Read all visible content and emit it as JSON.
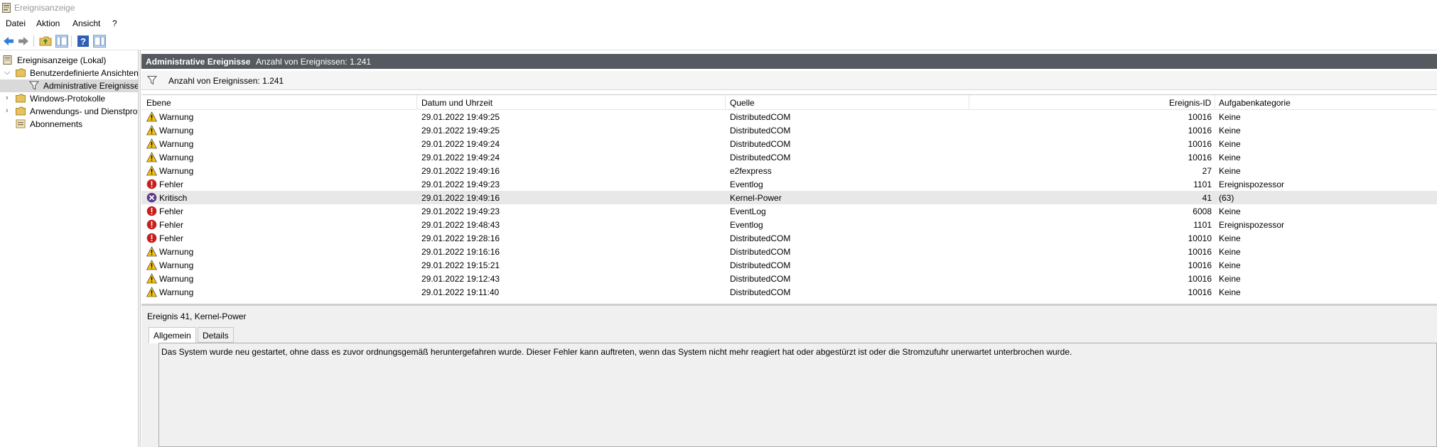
{
  "window": {
    "title": "Ereignisanzeige"
  },
  "menu": [
    {
      "label": "Datei"
    },
    {
      "label": "Aktion"
    },
    {
      "label": "Ansicht"
    },
    {
      "label": "?"
    }
  ],
  "toolbar": {
    "icons": [
      "back-arrow-icon",
      "forward-arrow-icon",
      "folder-up-icon",
      "show-hide-tree-icon",
      "help-icon",
      "show-hide-action-pane-icon"
    ]
  },
  "tree": {
    "root": "Ereignisanzeige (Lokal)",
    "custom_views": "Benutzerdefinierte Ansichten",
    "admin_events": "Administrative Ereignisse",
    "windows_logs": "Windows-Protokolle",
    "app_logs": "Anwendungs- und Dienstprotokolle",
    "subscriptions": "Abonnements"
  },
  "pane": {
    "title": "Administrative Ereignisse",
    "count": "Anzahl von Ereignissen: 1.241"
  },
  "filter": {
    "text": "Anzahl von Ereignissen: 1.241"
  },
  "columns": {
    "level": "Ebene",
    "datetime": "Datum und Uhrzeit",
    "source": "Quelle",
    "event_id": "Ereignis-ID",
    "category": "Aufgabenkategorie"
  },
  "colors": {
    "warning": "#f4c20d",
    "error": "#c81e1e",
    "critical": "#5b3a8a",
    "header_bg": "#555a60"
  },
  "rows": [
    {
      "level": "Warnung",
      "type": "warning",
      "datetime": "29.01.2022 19:49:25",
      "source": "DistributedCOM",
      "event_id": "10016",
      "category": "Keine"
    },
    {
      "level": "Warnung",
      "type": "warning",
      "datetime": "29.01.2022 19:49:25",
      "source": "DistributedCOM",
      "event_id": "10016",
      "category": "Keine"
    },
    {
      "level": "Warnung",
      "type": "warning",
      "datetime": "29.01.2022 19:49:24",
      "source": "DistributedCOM",
      "event_id": "10016",
      "category": "Keine"
    },
    {
      "level": "Warnung",
      "type": "warning",
      "datetime": "29.01.2022 19:49:24",
      "source": "DistributedCOM",
      "event_id": "10016",
      "category": "Keine"
    },
    {
      "level": "Warnung",
      "type": "warning",
      "datetime": "29.01.2022 19:49:16",
      "source": "e2fexpress",
      "event_id": "27",
      "category": "Keine"
    },
    {
      "level": "Fehler",
      "type": "error",
      "datetime": "29.01.2022 19:49:23",
      "source": "Eventlog",
      "event_id": "1101",
      "category": "Ereignispozessor"
    },
    {
      "level": "Kritisch",
      "type": "critical",
      "datetime": "29.01.2022 19:49:16",
      "source": "Kernel-Power",
      "event_id": "41",
      "category": "(63)",
      "selected": true
    },
    {
      "level": "Fehler",
      "type": "error",
      "datetime": "29.01.2022 19:49:23",
      "source": "EventLog",
      "event_id": "6008",
      "category": "Keine"
    },
    {
      "level": "Fehler",
      "type": "error",
      "datetime": "29.01.2022 19:48:43",
      "source": "Eventlog",
      "event_id": "1101",
      "category": "Ereignispozessor"
    },
    {
      "level": "Fehler",
      "type": "error",
      "datetime": "29.01.2022 19:28:16",
      "source": "DistributedCOM",
      "event_id": "10010",
      "category": "Keine"
    },
    {
      "level": "Warnung",
      "type": "warning",
      "datetime": "29.01.2022 19:16:16",
      "source": "DistributedCOM",
      "event_id": "10016",
      "category": "Keine"
    },
    {
      "level": "Warnung",
      "type": "warning",
      "datetime": "29.01.2022 19:15:21",
      "source": "DistributedCOM",
      "event_id": "10016",
      "category": "Keine"
    },
    {
      "level": "Warnung",
      "type": "warning",
      "datetime": "29.01.2022 19:12:43",
      "source": "DistributedCOM",
      "event_id": "10016",
      "category": "Keine"
    },
    {
      "level": "Warnung",
      "type": "warning",
      "datetime": "29.01.2022 19:11:40",
      "source": "DistributedCOM",
      "event_id": "10016",
      "category": "Keine"
    }
  ],
  "detail": {
    "title": "Ereignis 41, Kernel-Power",
    "tabs": [
      {
        "label": "Allgemein"
      },
      {
        "label": "Details"
      }
    ],
    "message": "Das System wurde neu gestartet, ohne dass es zuvor ordnungsgemäß heruntergefahren wurde. Dieser Fehler kann auftreten, wenn das System nicht mehr reagiert hat oder abgestürzt ist oder die Stromzufuhr unerwartet unterbrochen wurde."
  }
}
